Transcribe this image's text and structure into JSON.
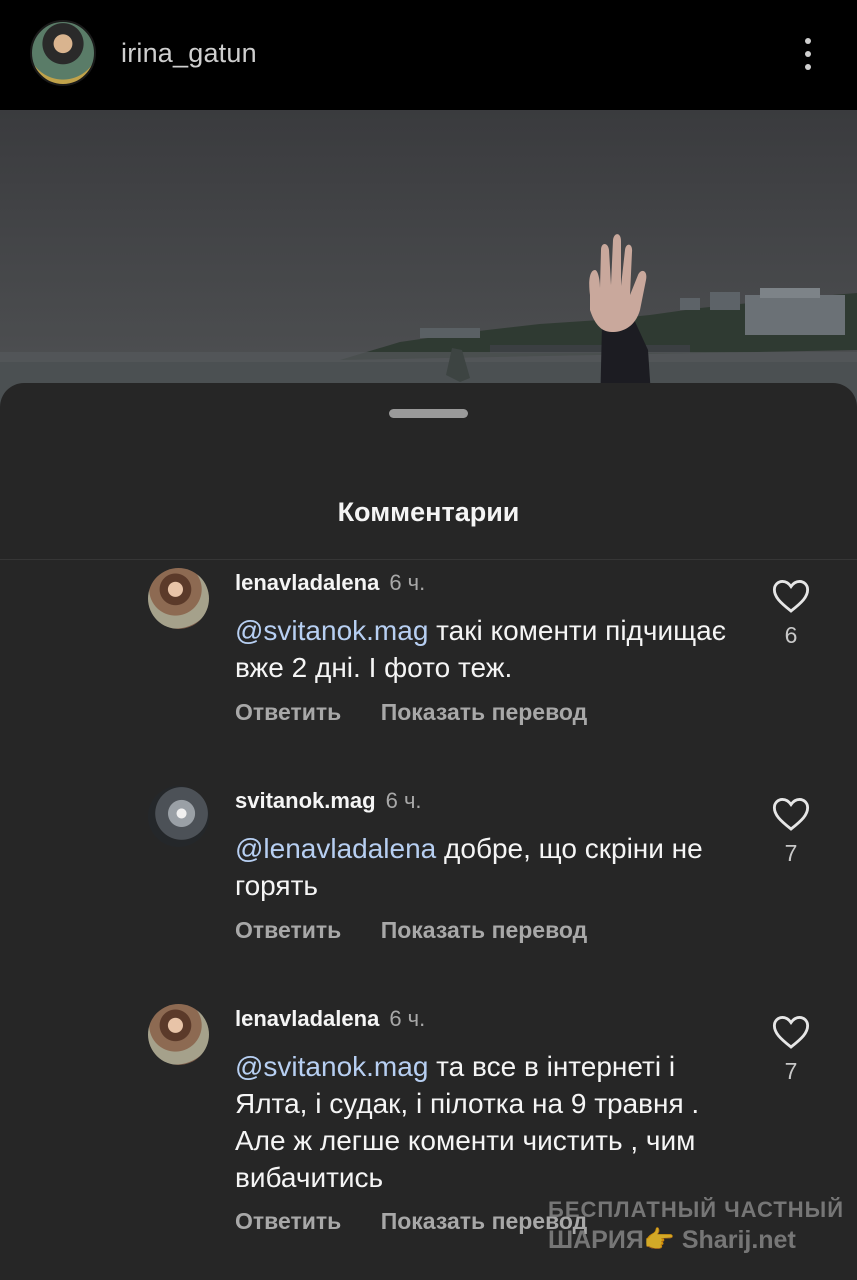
{
  "header": {
    "username": "irina_gatun",
    "avatar_icon": "profile-avatar",
    "more_icon": "vertical-dots-icon"
  },
  "sheet": {
    "title": "Комментарии"
  },
  "comments": [
    {
      "user": "lenavladalena",
      "time": "6 ч.",
      "mention": "@svitanok.mag",
      "text": " такі коменти підчищає вже 2 дні. І фото теж.",
      "reply": "Ответить",
      "translate": "Показать перевод",
      "likes": "6"
    },
    {
      "user": "svitanok.mag",
      "time": "6 ч.",
      "mention": "@lenavladalena",
      "text": " добре, що скріни не горять",
      "reply": "Ответить",
      "translate": "Показать перевод",
      "likes": "7"
    },
    {
      "user": "lenavladalena",
      "time": "6 ч.",
      "mention": "@svitanok.mag",
      "text": " та все в інтернеті і Ялта, і судак,  і пілотка на 9 травня . Але ж  легше коменти чистить , чим вибачитись",
      "reply": "Ответить",
      "translate": "Показать перевод",
      "likes": "7"
    }
  ],
  "watermark": {
    "line1": "БЕСПЛАТНЫЙ ЧАСТНЫЙ",
    "line2": "ШАРИЯ👉 Sharij.net"
  },
  "colors": {
    "background": "#000000",
    "sheet": "#262626",
    "mention": "#b7cff2",
    "secondary_text": "#a8a8a8"
  }
}
